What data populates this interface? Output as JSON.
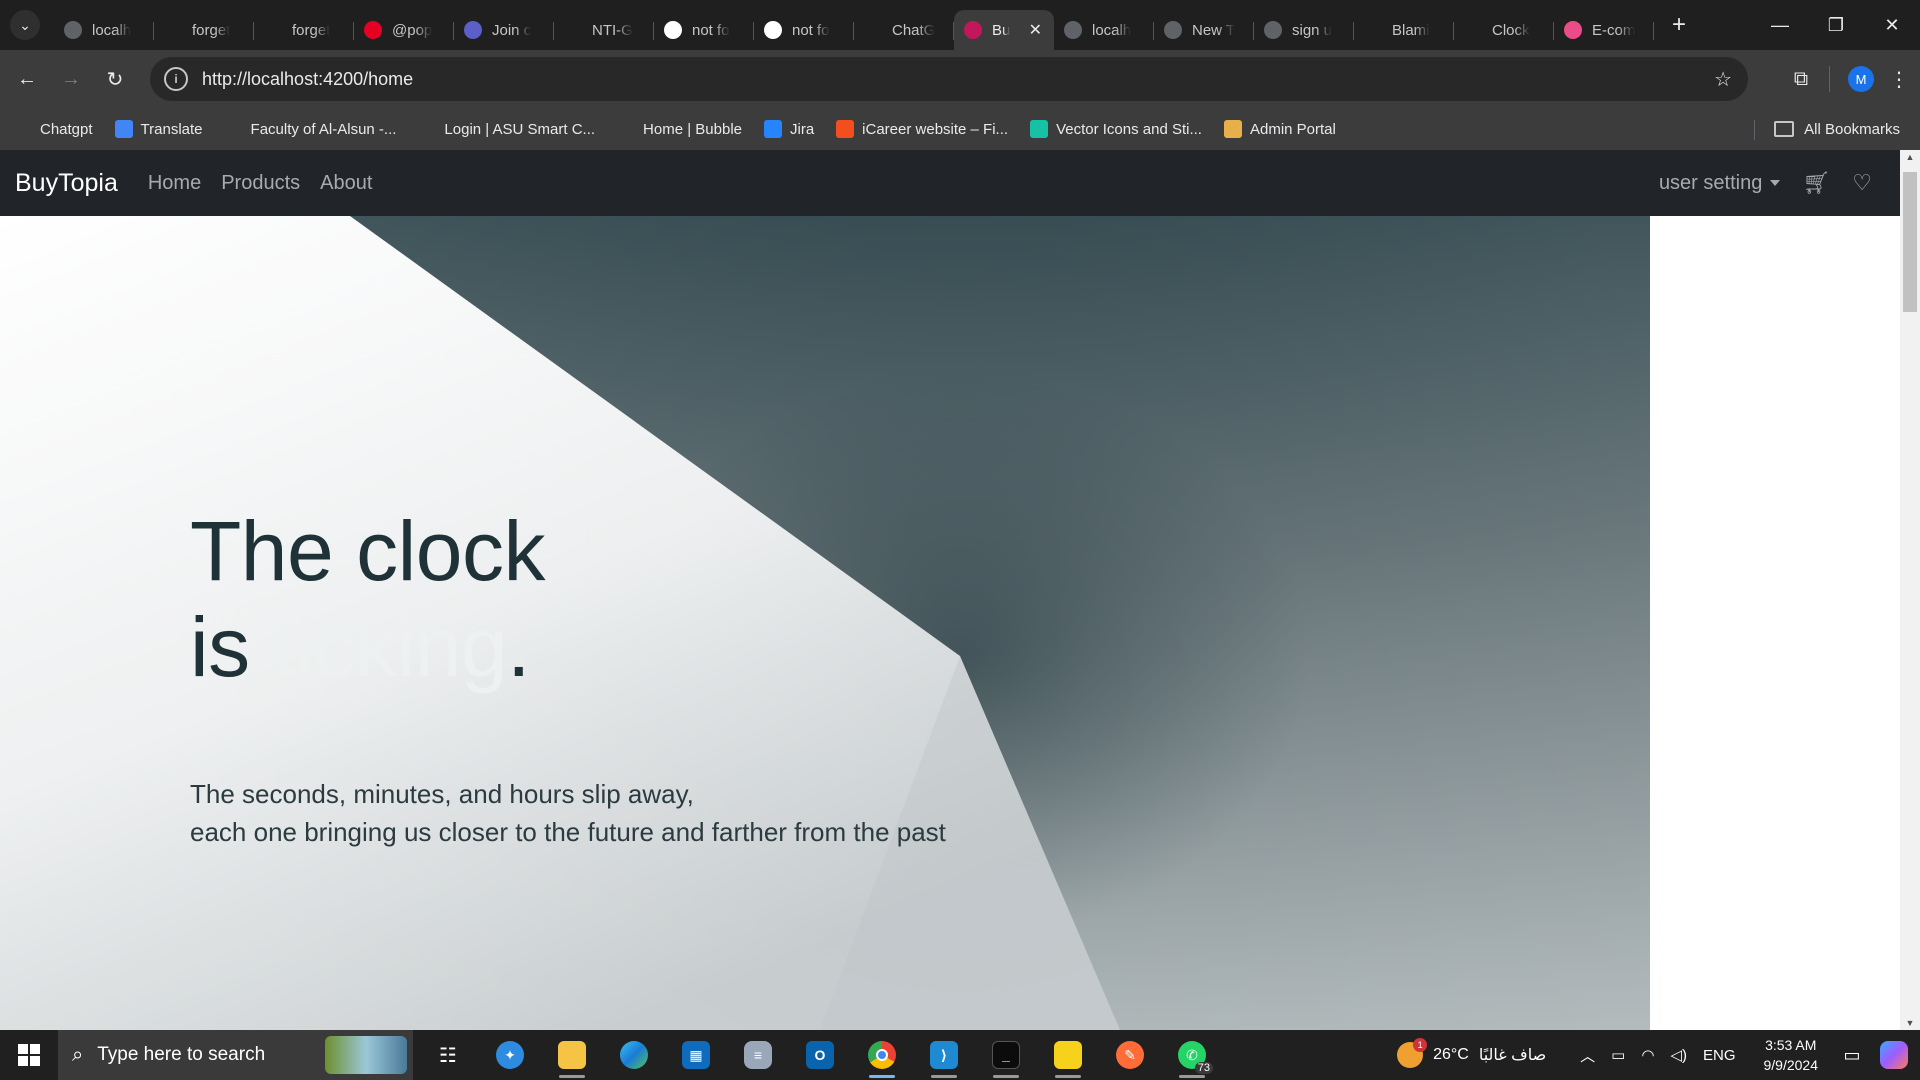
{
  "browser": {
    "tabs": [
      {
        "label": "localh",
        "icon": "angular-icon",
        "color": "#5f6368"
      },
      {
        "label": "forget",
        "icon": "github-icon",
        "color": "#1f1f1f"
      },
      {
        "label": "forget",
        "icon": "github-icon",
        "color": "#1f1f1f"
      },
      {
        "label": "@pop",
        "icon": "pinterest-icon",
        "color": "#e60023"
      },
      {
        "label": "Join c",
        "icon": "teams-icon",
        "color": "#5b5fc7"
      },
      {
        "label": "NTI-G",
        "icon": "github-icon",
        "color": "#1f1f1f"
      },
      {
        "label": "not fo",
        "icon": "google-icon",
        "color": "#ffffff"
      },
      {
        "label": "not fo",
        "icon": "google-icon",
        "color": "#ffffff"
      },
      {
        "label": "ChatG",
        "icon": "chatgpt-icon",
        "color": "#1f1f1f"
      },
      {
        "label": "Bu",
        "icon": "angular-icon",
        "color": "#c2185b",
        "active": true
      },
      {
        "label": "localh",
        "icon": "globe-icon",
        "color": "#5f6368"
      },
      {
        "label": "New T",
        "icon": "chrome-icon",
        "color": "#5f6368"
      },
      {
        "label": "sign u",
        "icon": "globe-icon",
        "color": "#5f6368"
      },
      {
        "label": "Blami",
        "icon": "github-icon",
        "color": "#1f1f1f"
      },
      {
        "label": "Clock",
        "icon": "codepen-icon",
        "color": "#1f1f1f"
      },
      {
        "label": "E-com",
        "icon": "dribbble-icon",
        "color": "#ea4c89"
      }
    ],
    "url": "http://localhost:4200/home",
    "profile_initial": "M",
    "bookmarks": [
      {
        "label": "Chatgpt",
        "icon": "chatgpt-icon",
        "color": "#3c3c3c"
      },
      {
        "label": "Translate",
        "icon": "translate-icon",
        "color": "#4285f4"
      },
      {
        "label": "Faculty of Al-Alsun -...",
        "icon": "dash-icon",
        "color": "#3c3c3c"
      },
      {
        "label": "Login | ASU Smart C...",
        "icon": "triangle-icon",
        "color": "#3c3c3c"
      },
      {
        "label": "Home | Bubble",
        "icon": "bubble-icon",
        "color": "#3c3c3c"
      },
      {
        "label": "Jira",
        "icon": "jira-icon",
        "color": "#2684ff"
      },
      {
        "label": "iCareer website – Fi...",
        "icon": "figma-icon",
        "color": "#f24e1e"
      },
      {
        "label": "Vector Icons and Sti...",
        "icon": "vector-icon",
        "color": "#17c1a5"
      },
      {
        "label": "Admin Portal",
        "icon": "folder-icon",
        "color": "#e8b04a"
      }
    ],
    "all_bookmarks": "All Bookmarks"
  },
  "site": {
    "brand": "BuyTopia",
    "nav": [
      "Home",
      "Products",
      "About"
    ],
    "user_menu": "user setting"
  },
  "hero": {
    "title_line1": "The clock",
    "title_is": "is",
    "title_highlight": "ticking",
    "title_dot": ".",
    "sub_line1": "The seconds, minutes, and hours slip away,",
    "sub_line2": "each one bringing us closer to the future and farther from the past"
  },
  "taskbar": {
    "search_placeholder": "Type here to search",
    "whatsapp_badge": "73",
    "weather_badge": "1",
    "temperature": "26°C",
    "weather_text": "صاف غالبًا",
    "language": "ENG",
    "time": "3:53 AM",
    "date": "9/9/2024"
  }
}
